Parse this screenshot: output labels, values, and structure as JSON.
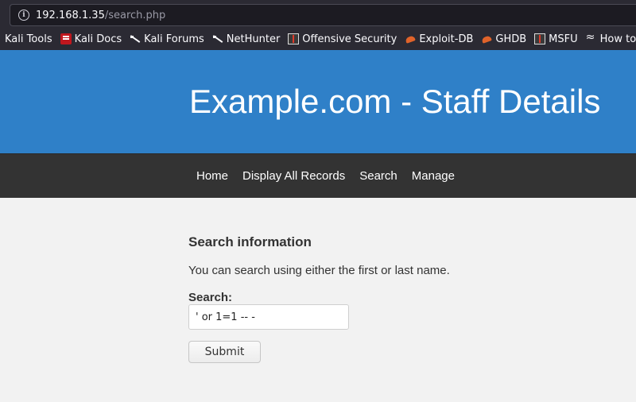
{
  "browser": {
    "url_host": "192.168.1.35",
    "url_path": "/search.php",
    "bookmarks": [
      {
        "label": "Kali Tools",
        "icon": "none"
      },
      {
        "label": "Kali Docs",
        "icon": "kali-docs-icon"
      },
      {
        "label": "Kali Forums",
        "icon": "kali-dragon-icon"
      },
      {
        "label": "NetHunter",
        "icon": "kali-dragon-icon"
      },
      {
        "label": "Offensive Security",
        "icon": "offsec-icon"
      },
      {
        "label": "Exploit-DB",
        "icon": "exploit-db-icon"
      },
      {
        "label": "GHDB",
        "icon": "exploit-db-icon"
      },
      {
        "label": "MSFU",
        "icon": "offsec-icon"
      },
      {
        "label": "How to",
        "icon": "wave-icon"
      }
    ]
  },
  "header": {
    "title": "Example.com - Staff Details"
  },
  "nav": {
    "home": "Home",
    "display_all": "Display All Records",
    "search": "Search",
    "manage": "Manage"
  },
  "main": {
    "section_title": "Search information",
    "hint": "You can search using either the first or last name.",
    "search_label": "Search:",
    "search_value": "' or 1=1 -- -",
    "submit_label": "Submit"
  },
  "colors": {
    "header_bg": "#2f80c8",
    "nav_bg": "#333333",
    "page_bg": "#f2f2f2",
    "chrome_bg": "#2b2a33"
  }
}
